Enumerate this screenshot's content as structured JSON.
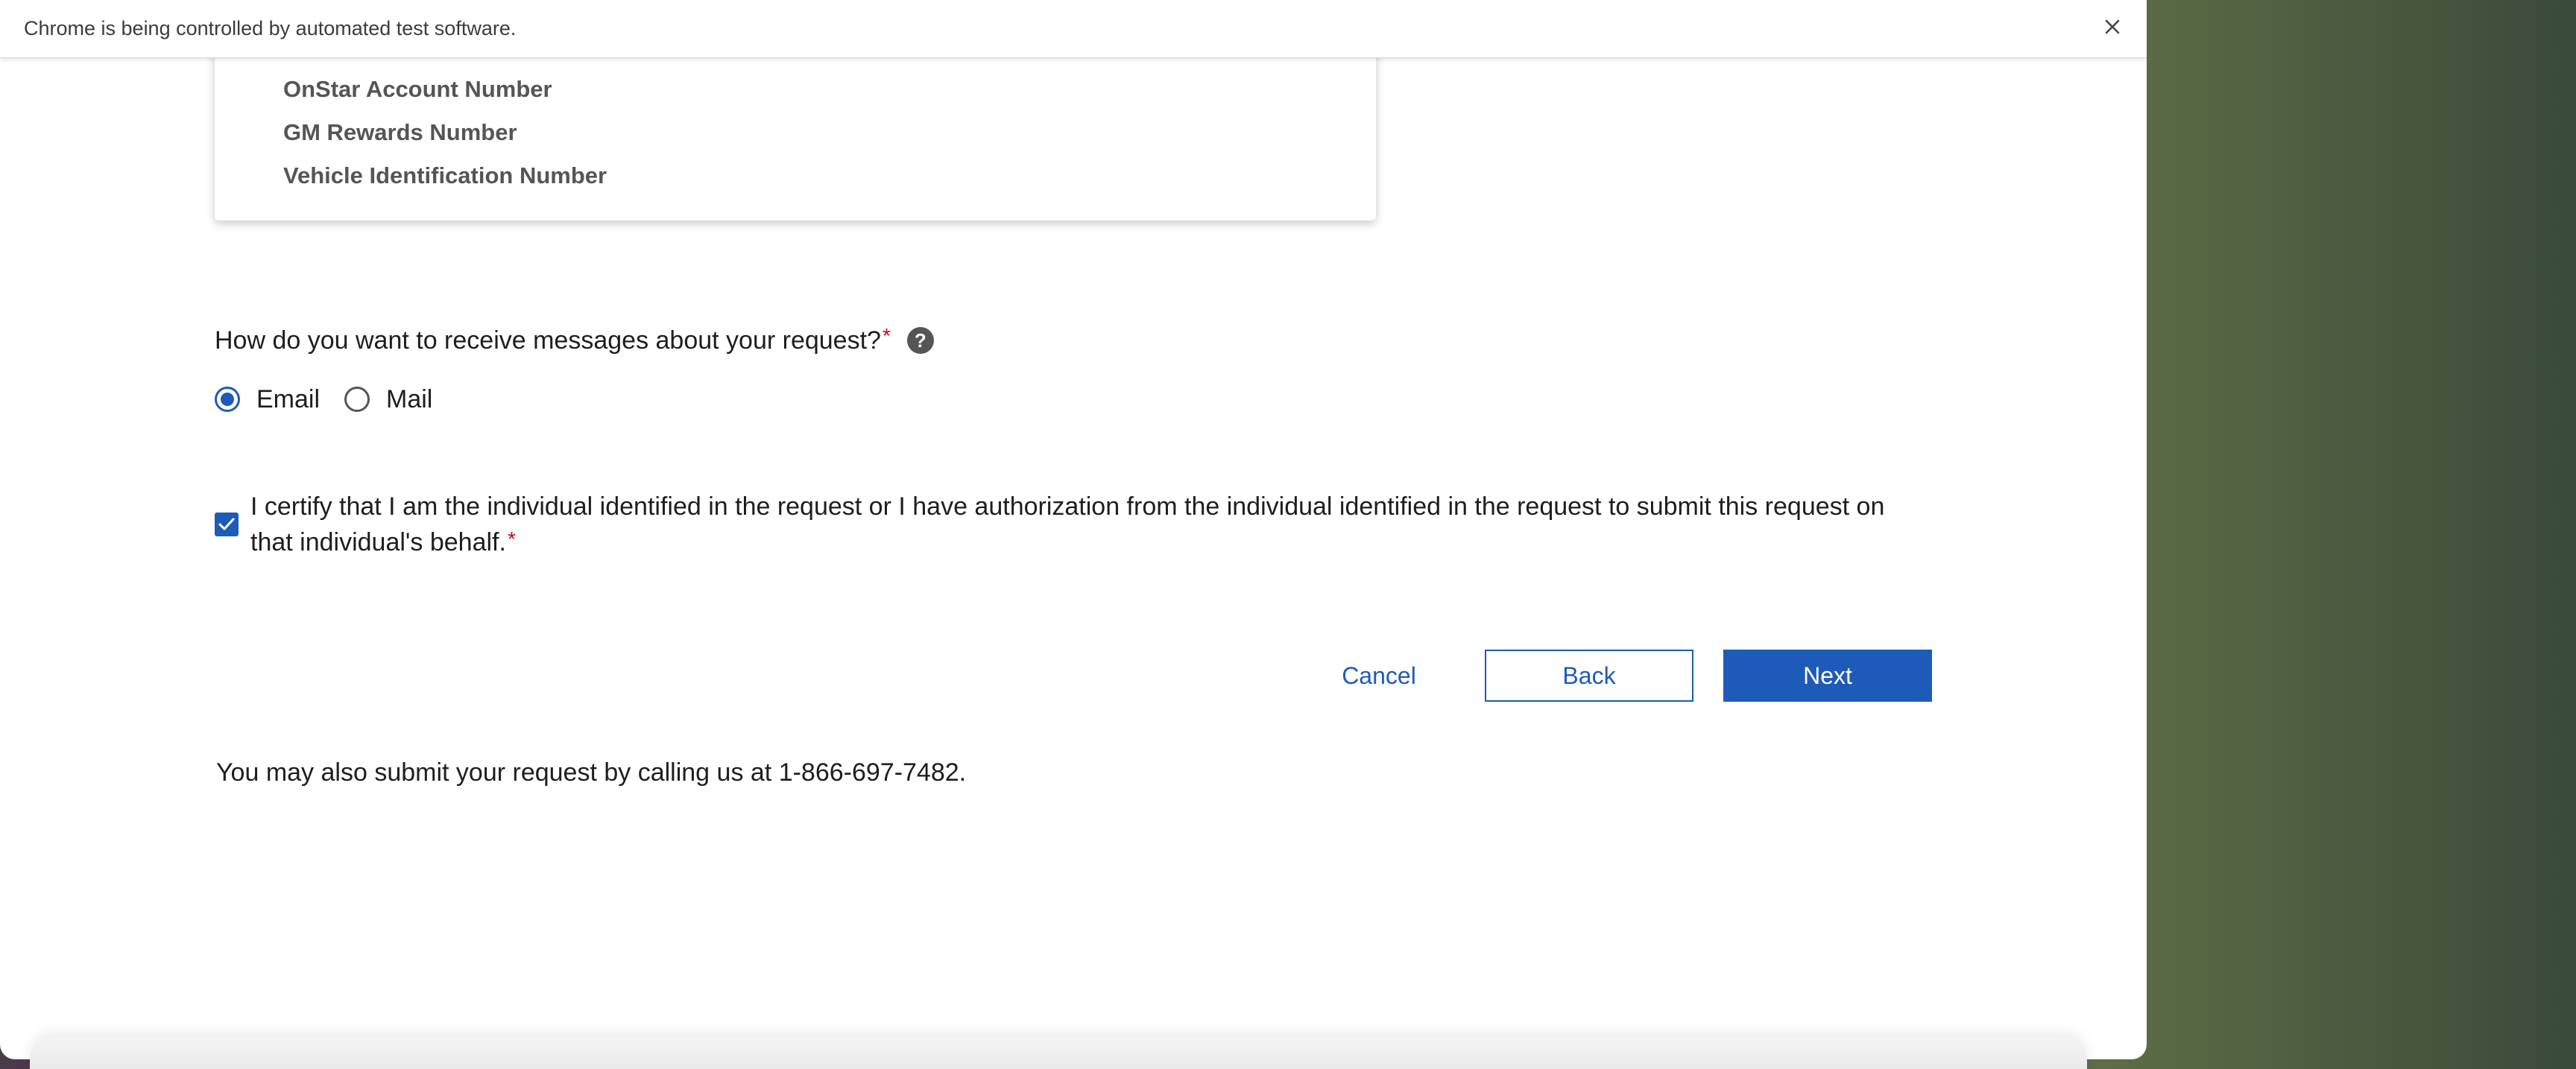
{
  "automation_bar": {
    "message": "Chrome is being controlled by automated test software.",
    "close_icon": "close-icon"
  },
  "id_options": {
    "items": [
      {
        "label": "OnStar Account Number"
      },
      {
        "label": "GM Rewards Number"
      },
      {
        "label": "Vehicle Identification Number"
      }
    ]
  },
  "contact_method": {
    "question": "How do you want to receive messages about your request?",
    "required_mark": "*",
    "help_icon": "question-mark-icon",
    "help_glyph": "?",
    "options": [
      {
        "label": "Email",
        "selected": true
      },
      {
        "label": "Mail",
        "selected": false
      }
    ]
  },
  "certification": {
    "text": "I certify that I am the individual identified in the request or I have authorization from the individual identified in the request to submit this request on that individual's behalf.",
    "required_mark": "*",
    "checked": true
  },
  "actions": {
    "cancel_label": "Cancel",
    "back_label": "Back",
    "next_label": "Next"
  },
  "footer_note": "You may also submit your request by calling us at 1-866-697-7482.",
  "colors": {
    "accent": "#1e5bb8",
    "required": "#d0021b",
    "help_icon_bg": "#555555"
  }
}
